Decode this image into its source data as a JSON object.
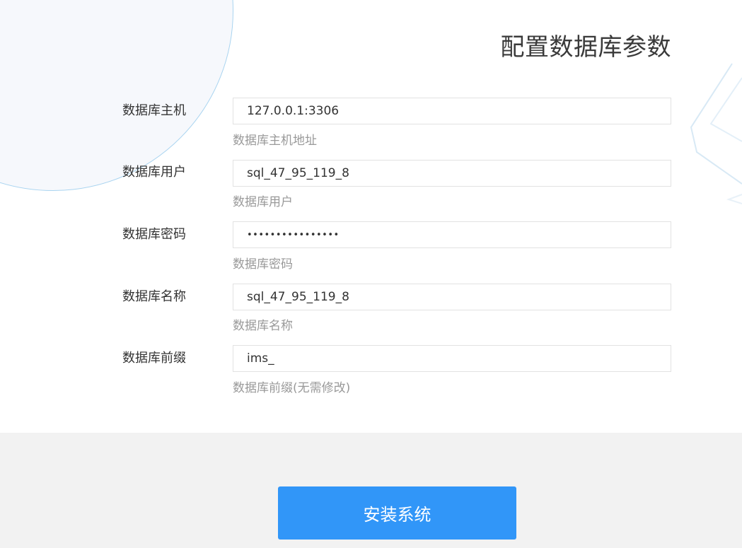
{
  "page": {
    "title": "配置数据库参数"
  },
  "form": {
    "fields": [
      {
        "label": "数据库主机",
        "value": "127.0.0.1:3306",
        "help": "数据库主机地址",
        "type": "text"
      },
      {
        "label": "数据库用户",
        "value": "sql_47_95_119_8",
        "help": "数据库用户",
        "type": "text"
      },
      {
        "label": "数据库密码",
        "value": "••••••••••••••••",
        "help": "数据库密码",
        "type": "password"
      },
      {
        "label": "数据库名称",
        "value": "sql_47_95_119_8",
        "help": "数据库名称",
        "type": "text"
      },
      {
        "label": "数据库前缀",
        "value": "ims_",
        "help": "数据库前缀(无需修改)",
        "type": "text"
      }
    ]
  },
  "footer": {
    "install_label": "安装系统"
  },
  "colors": {
    "accent": "#3196f8",
    "footer_bg": "#f2f2f2",
    "circle_border": "#a9d4f0"
  }
}
